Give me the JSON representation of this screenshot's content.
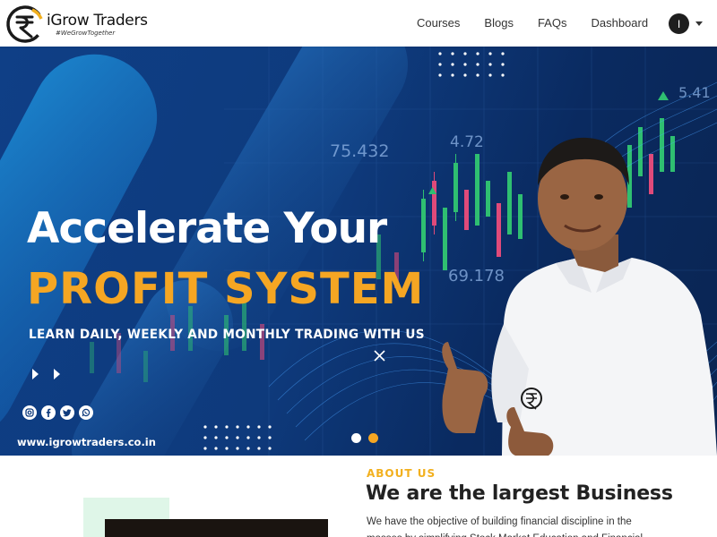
{
  "brand": {
    "name": "iGrow Traders",
    "tagline": "#WeGrowTogether"
  },
  "nav": {
    "items": [
      {
        "label": "Courses"
      },
      {
        "label": "Blogs"
      },
      {
        "label": "FAQs"
      },
      {
        "label": "Dashboard"
      }
    ],
    "avatar_initial": "I"
  },
  "hero": {
    "title_line1": "Accelerate Your",
    "title_line2": "PROFIT SYSTEM",
    "subtitle": "LEARN DAILY, WEEKLY AND MONTHLY TRADING WITH US",
    "website": "www.igrowtraders.co.in",
    "chart_numbers": [
      "75.432",
      "4.72",
      "5.41",
      "69.178"
    ],
    "social_icons": [
      "instagram-icon",
      "facebook-icon",
      "twitter-icon",
      "whatsapp-icon"
    ],
    "slides": {
      "count": 2,
      "active_index": 1
    },
    "colors": {
      "accent": "#f5a623",
      "background": "#0e3a7c"
    }
  },
  "about": {
    "label": "ABOUT US",
    "title": "We are the largest Business",
    "text": "We have the objective of building financial discipline in the masses by simplifying Stock Market Education and Financial"
  }
}
